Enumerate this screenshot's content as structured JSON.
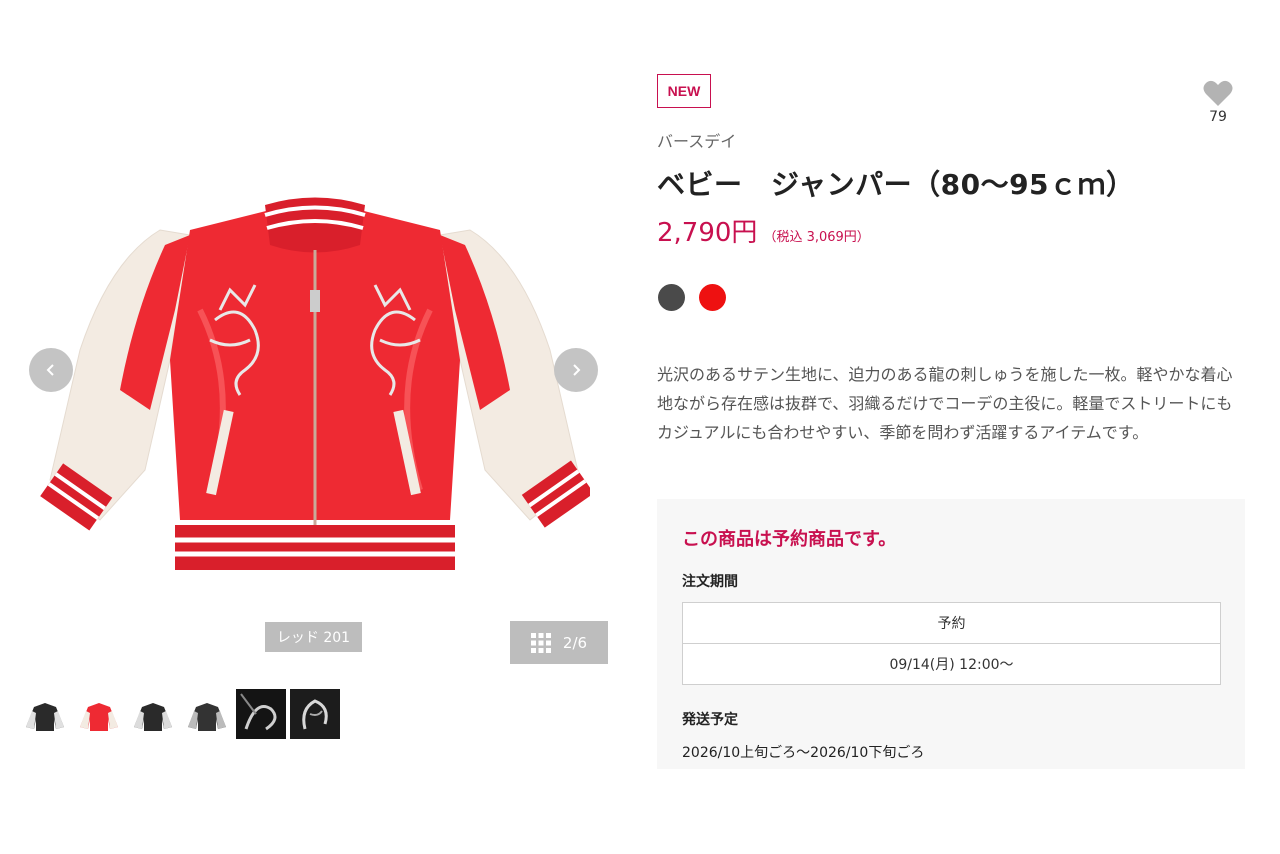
{
  "gallery": {
    "prev_icon": "chevron-left-icon",
    "next_icon": "chevron-right-icon",
    "color_label": "レッド 201",
    "page_indicator": "2/6",
    "thumbnails": [
      {
        "color": "black"
      },
      {
        "color": "red"
      },
      {
        "color": "black"
      },
      {
        "color": "black"
      },
      {
        "color": "black-detail"
      },
      {
        "color": "black-detail"
      }
    ]
  },
  "product": {
    "badge": "NEW",
    "brand": "バースデイ",
    "title": "ベビー　ジャンパー（80～95ｃｍ）",
    "price": "2,790円",
    "price_tax": "（税込 3,069円）",
    "favorite_count": "79",
    "colors": [
      "#4a4a4a",
      "#ee1111"
    ],
    "description": "光沢のあるサテン生地に、迫力のある龍の刺しゅうを施した一枚。軽やかな着心地ながら存在感は抜群で、羽織るだけでコーデの主役に。軽量でストリートにもカジュアルにも合わせやすい、季節を問わず活躍するアイテムです。"
  },
  "reservation": {
    "heading": "この商品は予約商品です。",
    "period_label": "注文期間",
    "period_header": "予約",
    "period_value": "09/14(月) 12:00～",
    "ship_label": "発送予定",
    "ship_value": "2026/10上旬ごろ～2026/10下旬ごろ"
  },
  "colors": {
    "accent": "#c8104f",
    "jacket_red": "#ee2a33",
    "sleeve_cream": "#f4ece4"
  }
}
